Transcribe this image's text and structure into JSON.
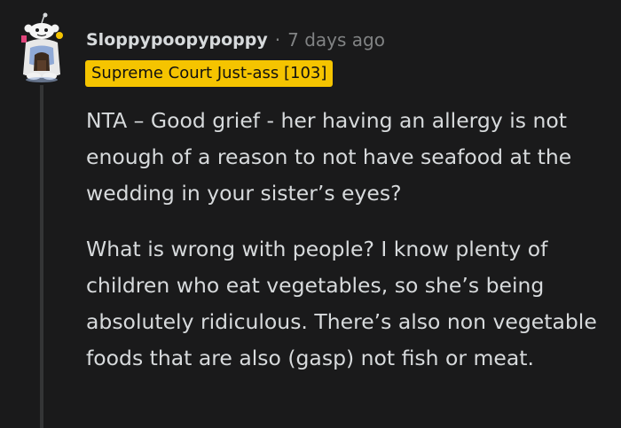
{
  "comment": {
    "username": "Sloppypoopypoppy",
    "separator": "·",
    "timestamp": "7 days ago",
    "flair": "Supreme Court Just-ass [103]",
    "paragraphs": [
      "NTA – Good grief - her having an allergy is not enough of a reason to not have seafood at the wedding in your sister’s eyes?",
      "What is wrong with people? I know plenty of children who eat vegetables, so she’s being absolutely ridiculous. There’s also non vegetable foods that are also (gasp) not fish or meat."
    ]
  },
  "colors": {
    "background": "#1a1a1b",
    "text": "#d7dadc",
    "meta": "#818384",
    "flair_bg": "#f5c400",
    "thread_line": "#343536"
  },
  "icons": {
    "avatar": "snoo-avatar-icon"
  }
}
